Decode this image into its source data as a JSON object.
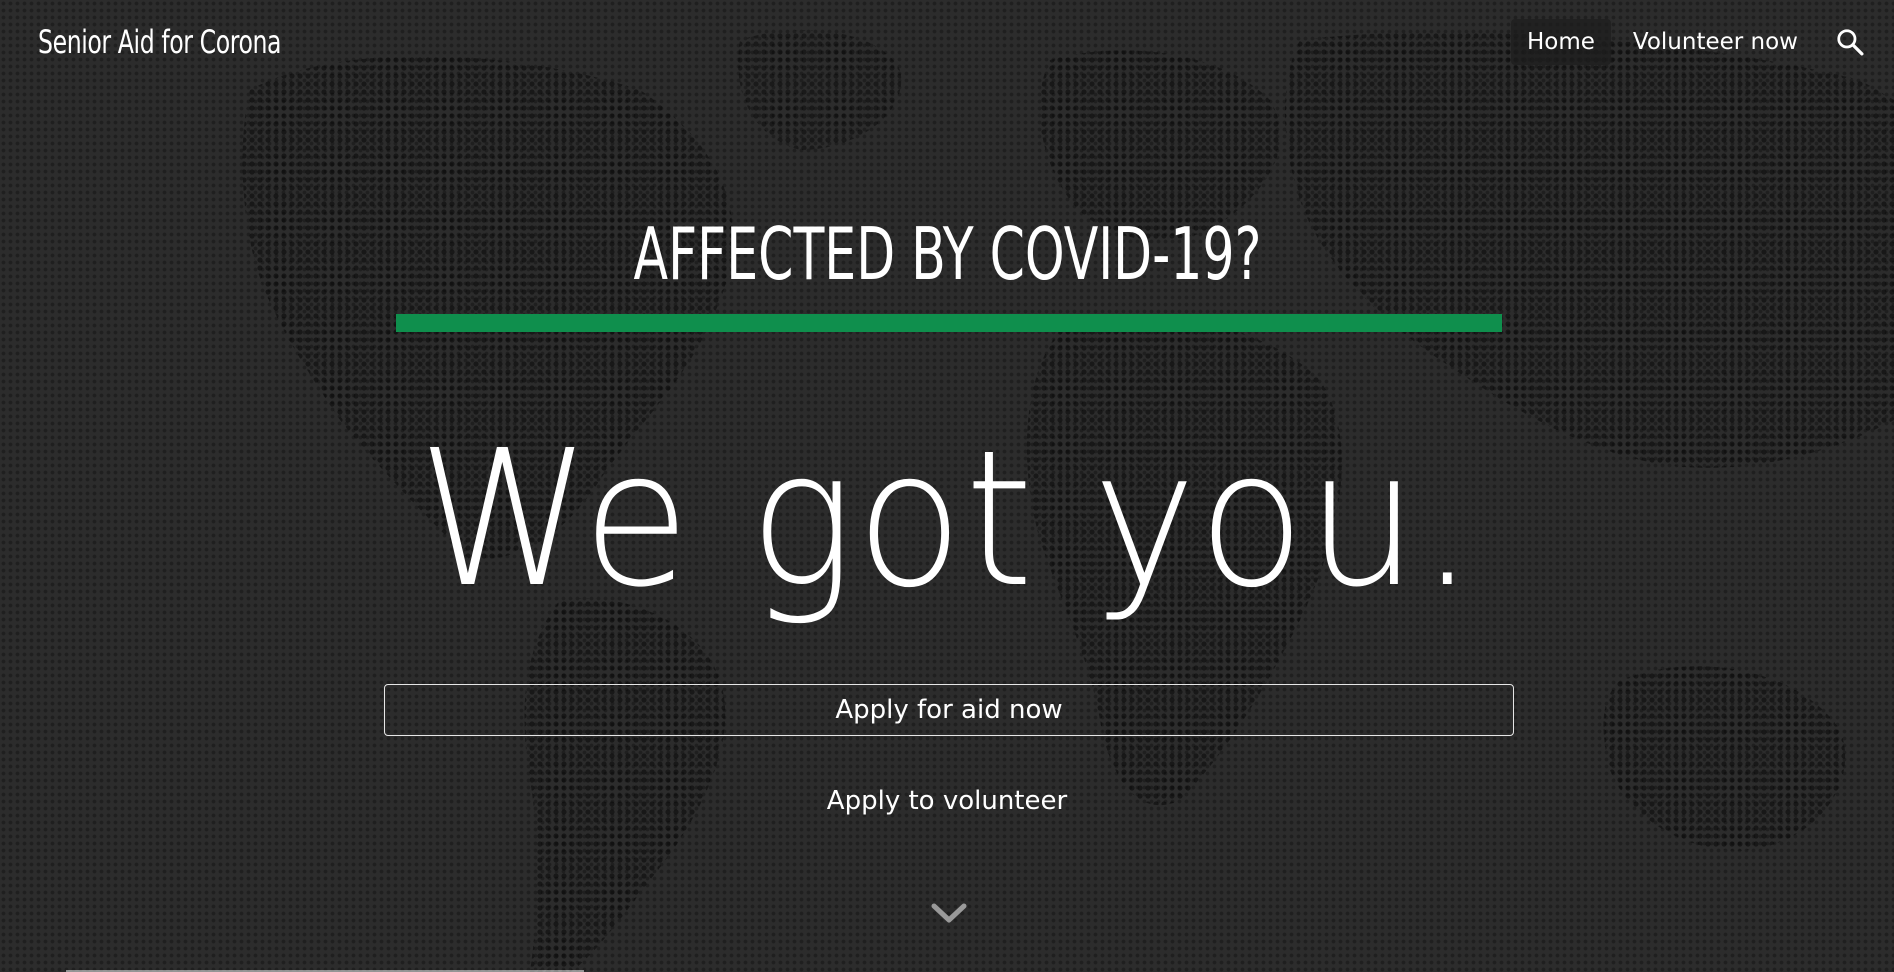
{
  "header": {
    "site_title": "Senior Aid for Corona",
    "nav": [
      {
        "label": "Home",
        "active": true
      },
      {
        "label": "Volunteer now",
        "active": false
      }
    ],
    "search_icon": "search-icon"
  },
  "hero": {
    "heading": "AFFECTED BY COVID-19?",
    "headline": "We got you.",
    "primary_button": "Apply for aid now",
    "secondary_link": "Apply to volunteer",
    "scroll_icon": "chevron-down-icon"
  },
  "colors": {
    "background": "#2c2c2c",
    "accent": "#0f8f4d",
    "text": "#ffffff"
  }
}
